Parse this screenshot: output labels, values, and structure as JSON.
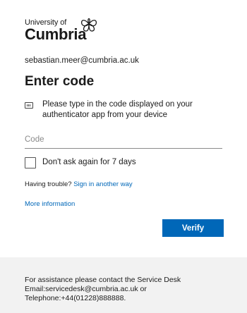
{
  "brand": {
    "university_of": "University of",
    "cumbria": "Cumbria"
  },
  "identity": "sebastian.meer@cumbria.ac.uk",
  "title": "Enter code",
  "instruction": "Please type in the code displayed on your authenticator app from your device",
  "code_field": {
    "placeholder": "Code",
    "value": ""
  },
  "remember_checkbox": {
    "label": "Don't ask again for 7 days",
    "checked": false
  },
  "trouble": {
    "prefix": "Having trouble?",
    "link": "Sign in another way"
  },
  "more_info_link": "More information",
  "verify_button": "Verify",
  "footer": {
    "line1": "For assistance please contact the Service Desk",
    "line2": "Email:servicedesk@cumbria.ac.uk or",
    "line3": "Telephone:+44(01228)888888."
  },
  "colors": {
    "accent": "#0067b8",
    "footer_bg": "#f2f2f2"
  },
  "icons": {
    "instruction_icon": "authenticator-app-icon",
    "logo_mark": "flower-emblem-icon"
  }
}
